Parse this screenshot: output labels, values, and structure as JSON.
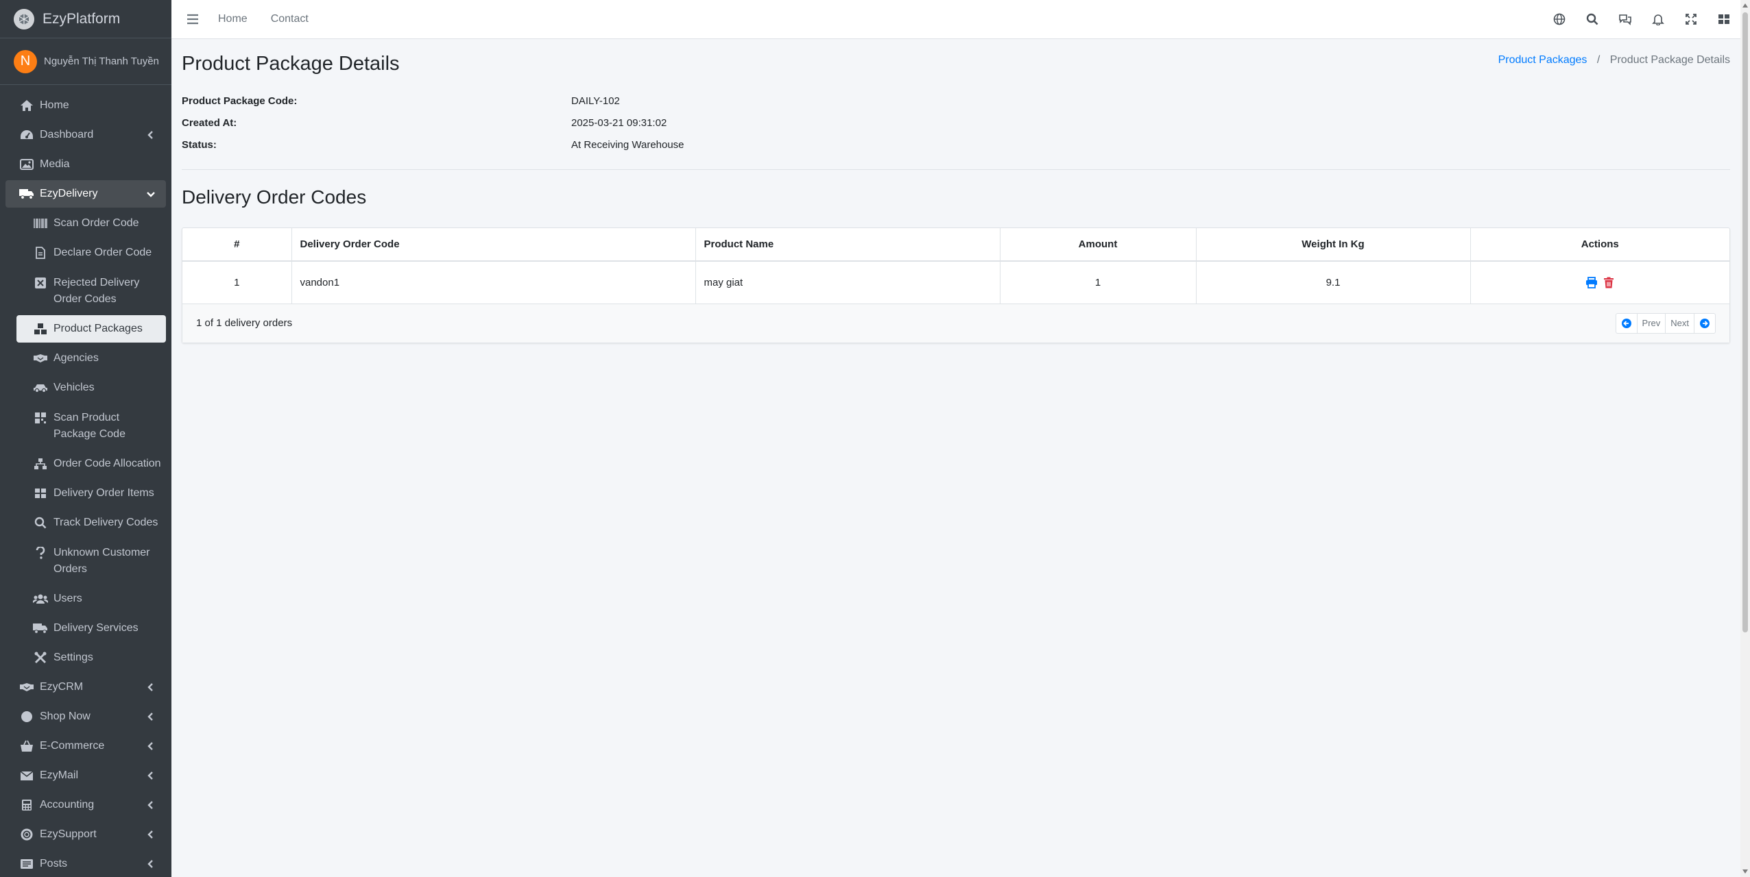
{
  "brand": {
    "name": "EzyPlatform"
  },
  "user": {
    "initial": "N",
    "name": "Nguyễn Thị Thanh Tuyền"
  },
  "sidebar": {
    "items": [
      {
        "label": "Home"
      },
      {
        "label": "Dashboard"
      },
      {
        "label": "Media"
      },
      {
        "label": "EzyDelivery"
      },
      {
        "label": "EzyCRM"
      },
      {
        "label": "Shop Now"
      },
      {
        "label": "E-Commerce"
      },
      {
        "label": "EzyMail"
      },
      {
        "label": "Accounting"
      },
      {
        "label": "EzySupport"
      },
      {
        "label": "Posts"
      }
    ],
    "sub_items": [
      {
        "label": "Scan Order Code"
      },
      {
        "label": "Declare Order Code"
      },
      {
        "label": "Rejected Delivery Order Codes"
      },
      {
        "label": "Product Packages"
      },
      {
        "label": "Agencies"
      },
      {
        "label": "Vehicles"
      },
      {
        "label": "Scan Product Package Code"
      },
      {
        "label": "Order Code Allocation"
      },
      {
        "label": "Delivery Order Items"
      },
      {
        "label": "Track Delivery Codes"
      },
      {
        "label": "Unknown Customer Orders"
      },
      {
        "label": "Users"
      },
      {
        "label": "Delivery Services"
      },
      {
        "label": "Settings"
      }
    ]
  },
  "topbar": {
    "home": "Home",
    "contact": "Contact"
  },
  "page": {
    "title": "Product Package Details",
    "breadcrumb": {
      "parent": "Product Packages",
      "separator": "/",
      "current": "Product Package Details"
    }
  },
  "details": [
    {
      "label": "Product Package Code:",
      "value": "DAILY-102"
    },
    {
      "label": "Created At:",
      "value": "2025-03-21 09:31:02"
    },
    {
      "label": "Status:",
      "value": "At Receiving Warehouse"
    }
  ],
  "orders": {
    "title": "Delivery Order Codes",
    "columns": [
      "#",
      "Delivery Order Code",
      "Product Name",
      "Amount",
      "Weight In Kg",
      "Actions"
    ],
    "rows": [
      {
        "index": "1",
        "code": "vandon1",
        "product": "may giat",
        "amount": "1",
        "weight": "9.1"
      }
    ],
    "summary": "1 of 1 delivery orders",
    "pager": {
      "prev": "Prev",
      "next": "Next"
    }
  },
  "colors": {
    "sidebar": "#343a40",
    "accent": "#007bff",
    "danger": "#dc3545",
    "avatar": "#fd7e14"
  }
}
